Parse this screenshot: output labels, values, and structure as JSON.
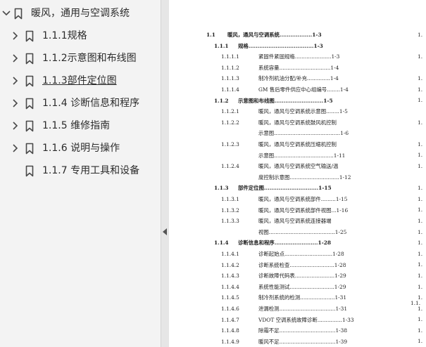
{
  "sidebar": {
    "items": [
      {
        "label": "暖风，通用与空调系统",
        "level": 0,
        "chevron": "down"
      },
      {
        "label": "1.1.1规格",
        "level": 1,
        "chevron": "right"
      },
      {
        "label": "1.1.2示意图和布线图",
        "level": 1,
        "chevron": "right"
      },
      {
        "label": "1.1.3部件定位图",
        "level": 1,
        "chevron": "right",
        "active": true
      },
      {
        "label": "1.1.4 诊断信息和程序",
        "level": 1,
        "chevron": "right"
      },
      {
        "label": "1.1.5 维修指南",
        "level": 1,
        "chevron": "right"
      },
      {
        "label": "1.1.6 说明与操作",
        "level": 1,
        "chevron": "right"
      },
      {
        "label": "1.1.7 专用工具和设备",
        "level": 1,
        "chevron": "none"
      }
    ]
  },
  "toc": [
    {
      "num": "1.1",
      "title": "暖风，通风与空调系统",
      "dots": "..................",
      "page": "1-3",
      "level": 1
    },
    {
      "num": "1.1.1",
      "title": "规格",
      "dots": "....................................",
      "page": "1-3",
      "level": 2
    },
    {
      "num": "1.1.1.1",
      "title": "紧固件紧固规格",
      "dots": "......................",
      "page": "1-3",
      "level": 3
    },
    {
      "num": "1.1.1.2",
      "title": "系统容量",
      "dots": "...............................",
      "page": "1-4",
      "level": 3
    },
    {
      "num": "1.1.1.3",
      "title": "制冷剂机油分配/补充",
      "dots": "..............",
      "page": "1-4",
      "level": 3
    },
    {
      "num": "1.1.1.4",
      "title": "GM 售后零件供应中心组编号",
      "dots": "........",
      "page": "1-4",
      "level": 3
    },
    {
      "num": "1.1.2",
      "title": "示意图和布线图",
      "dots": "...........................",
      "page": "1-5",
      "level": 2
    },
    {
      "num": "1.1.2.1",
      "title": "暖风，通风与空调系统示意图",
      "dots": "........",
      "page": "1-5",
      "level": 3
    },
    {
      "num": "1.1.2.2",
      "title": "暖风，通风与空调系统鼓风机控制",
      "dots": "",
      "page": "",
      "level": 3
    },
    {
      "num": "",
      "title": "示意图",
      "dots": "........................................",
      "page": "1-6",
      "level": 4
    },
    {
      "num": "1.1.2.3",
      "title": "暖风，通风与空调系统压缩机控制",
      "dots": "",
      "page": "",
      "level": 3
    },
    {
      "num": "",
      "title": "示意图",
      "dots": "....................................",
      "page": "1-11",
      "level": 4
    },
    {
      "num": "1.1.2.4",
      "title": "暖风，通风与空调系统空气输送/温",
      "dots": "",
      "page": "",
      "level": 3
    },
    {
      "num": "",
      "title": "度控制示意图",
      "dots": "..............................",
      "page": "1-12",
      "level": 4
    },
    {
      "num": "1.1.3",
      "title": "部件定位图",
      "dots": "..............................",
      "page": "1-15",
      "level": 2
    },
    {
      "num": "1.1.3.1",
      "title": "暖风，通风与空调系统部件",
      "dots": ".........",
      "page": "1-15",
      "level": 3
    },
    {
      "num": "1.1.3.2",
      "title": "暖风，通风与空调系统部件视图",
      "dots": "...",
      "page": "1-16",
      "level": 3
    },
    {
      "num": "1.1.3.3",
      "title": "暖风，通风与空调系统连接器端",
      "dots": "",
      "page": "",
      "level": 3
    },
    {
      "num": "",
      "title": "视图",
      "dots": "........................................",
      "page": "1-25",
      "level": 4
    },
    {
      "num": "1.1.4",
      "title": "诊断信息和程序",
      "dots": "........................",
      "page": "1-28",
      "level": 2
    },
    {
      "num": "1.1.4.1",
      "title": "诊断起始点",
      "dots": ".............................",
      "page": "1-28",
      "level": 3
    },
    {
      "num": "1.1.4.2",
      "title": "诊断系统检查",
      "dots": "...........................",
      "page": "1-28",
      "level": 3
    },
    {
      "num": "1.1.4.3",
      "title": "诊断故障代码表",
      "dots": "........................",
      "page": "1-29",
      "level": 3
    },
    {
      "num": "1.1.4.4",
      "title": "系统性能测试",
      "dots": "...........................",
      "page": "1-29",
      "level": 3
    },
    {
      "num": "1.1.4.5",
      "title": "制冷剂系统的检测",
      "dots": ".....................",
      "page": "1-31",
      "level": 3
    },
    {
      "num": "1.1.4.6",
      "title": "泄漏检测",
      "dots": "..................................",
      "page": "1-31",
      "level": 3
    },
    {
      "num": "1.1.4.7",
      "title": "VDOT 空调系统故障诊断",
      "dots": "...............",
      "page": "1-33",
      "level": 3
    },
    {
      "num": "1.1.4.8",
      "title": "除霜不足",
      "dots": "..................................",
      "page": "1-38",
      "level": 3
    },
    {
      "num": "1.1.4.9",
      "title": "暖风不足",
      "dots": "..................................",
      "page": "1-39",
      "level": 3
    }
  ],
  "next_page_edge": [
    "1.",
    "1.",
    "1.",
    "1.",
    "1.",
    "1.",
    "1.",
    "1.",
    "1.",
    "1.",
    "1.",
    "1.",
    "1.",
    "1.",
    "1.",
    "1.",
    "1.",
    "1.",
    "1.",
    "1.",
    "1.1.",
    "1.",
    "1.",
    "1.",
    "1."
  ],
  "colors": {
    "sidebar_bg": "#f3f3f3",
    "divider_bg": "#e6e6e6",
    "icon_stroke": "#4a4a4a",
    "text": "#2b2b2b"
  }
}
